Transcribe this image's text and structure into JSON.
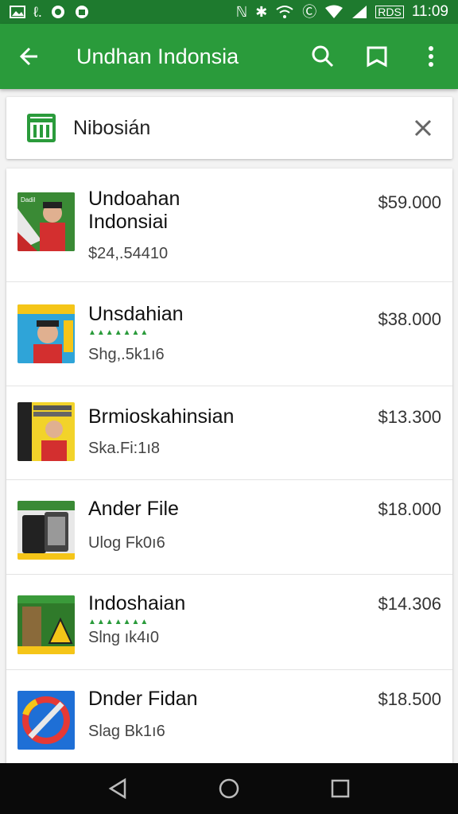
{
  "status_bar": {
    "time": "11:09",
    "left_icons": [
      "image-icon",
      "text-icon",
      "circle-icon",
      "android-icon"
    ],
    "right_icons": [
      "n-icon",
      "bluetooth-icon",
      "wifi-icon",
      "alarm-icon",
      "wifi-full-icon",
      "signal-icon"
    ],
    "battery_text": "RDS"
  },
  "app_bar": {
    "title": "Undhan Indonsia",
    "color": "#2a9b3b"
  },
  "search": {
    "value": "Nibosián"
  },
  "results": [
    {
      "title_lines": [
        "Undoahan",
        "Indonsiai"
      ],
      "subtitle": "$24,.54410",
      "price": "$59.000",
      "thumb": "person-flag"
    },
    {
      "title_lines": [
        "Unsdahian"
      ],
      "subtitle": "Shg,.5k1ı6",
      "price": "$38.000",
      "thumb": "person-blue",
      "rating_visible": true
    },
    {
      "title_lines": [
        "Brmioskahinsian"
      ],
      "subtitle": "Ska.Fi:1ı8",
      "price": "$13.300",
      "thumb": "person-yellow"
    },
    {
      "title_lines": [
        "Ander File"
      ],
      "subtitle": "Ulog Fk0ı6",
      "price": "$18.000",
      "thumb": "devices"
    },
    {
      "title_lines": [
        "Indoshaian"
      ],
      "subtitle": "Slng ık4ı0",
      "price": "$14.306",
      "thumb": "warning",
      "rating_visible": true
    },
    {
      "title_lines": [
        "Dnder Fidan"
      ],
      "subtitle": "Slag Bk1ı6",
      "price": "$18.500",
      "thumb": "forbidden"
    }
  ],
  "nav_bar": {
    "buttons": [
      "back-triangle-icon",
      "home-circle-icon",
      "recents-square-icon"
    ]
  }
}
